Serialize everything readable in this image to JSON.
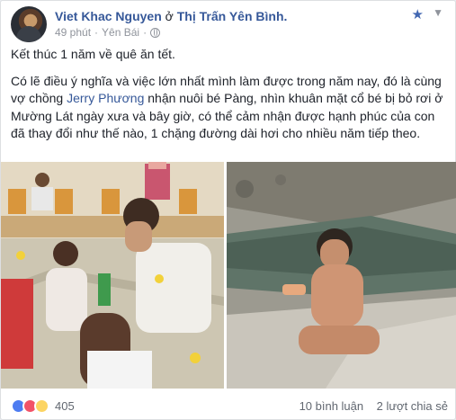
{
  "post": {
    "author": "Viet Khac Nguyen",
    "at_word": "ở",
    "location": "Thị Trấn Yên Bình.",
    "time": "49 phút",
    "place": "Yên Bái",
    "meta_sep": "·"
  },
  "body": {
    "line1": "Kết thúc 1 năm về quê ăn tết.",
    "p2_a": "Có lẽ điều ý nghĩa và việc lớn nhất mình làm được trong năm nay, đó là cùng vợ chồng ",
    "p2_tag": "Jerry Phương",
    "p2_b": " nhận nuôi bé Pàng, nhìn khuân mặt cổ bé bị bỏ rơi ở Mường Lát ngày xưa và bây giờ, có thể cảm nhận được hạnh phúc của con đã thay đổi như thế nào, 1 chặng đường dài hơi cho nhiều năm tiếp theo."
  },
  "footer": {
    "reaction_count": "405",
    "comments": "10 bình luận",
    "shares": "2 lượt chia sẻ"
  },
  "colors": {
    "link": "#365899",
    "muted": "#90949c",
    "like": "#4d7cf1",
    "love": "#f25268",
    "haha": "#fcd462"
  }
}
